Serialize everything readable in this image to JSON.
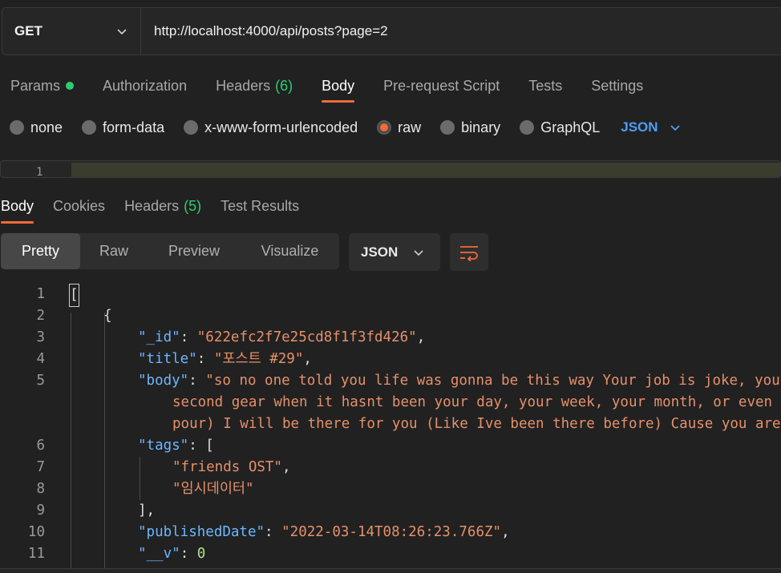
{
  "request": {
    "method": "GET",
    "url": "http://localhost:4000/api/posts?page=2"
  },
  "request_tabs": [
    {
      "label": "Params",
      "indicator": "green-dot"
    },
    {
      "label": "Authorization"
    },
    {
      "label": "Headers",
      "count": "(6)"
    },
    {
      "label": "Body",
      "active": true
    },
    {
      "label": "Pre-request Script"
    },
    {
      "label": "Tests"
    },
    {
      "label": "Settings"
    }
  ],
  "body_types": {
    "none": "none",
    "form_data": "form-data",
    "urlencoded": "x-www-form-urlencoded",
    "raw": "raw",
    "binary": "binary",
    "graphql": "GraphQL",
    "format": "JSON",
    "selected": "raw"
  },
  "request_editor": {
    "line_number": "1"
  },
  "response_tabs": {
    "body": "Body",
    "cookies": "Cookies",
    "headers": "Headers",
    "headers_count": "(5)",
    "test_results": "Test Results"
  },
  "view_modes": {
    "pretty": "Pretty",
    "raw": "Raw",
    "preview": "Preview",
    "visualize": "Visualize",
    "format": "JSON",
    "wrap_icon": "wrap-lines-icon"
  },
  "code_lines": [
    {
      "n": "1",
      "text": "["
    },
    {
      "n": "2",
      "text": "{"
    },
    {
      "n": "3",
      "key": "\"_id\"",
      "sep": ": ",
      "val": "\"622efc2f7e25cd8f1f3fd426\"",
      "end": ","
    },
    {
      "n": "4",
      "key": "\"title\"",
      "sep": ": ",
      "val": "\"포스트 #29\"",
      "end": ","
    },
    {
      "n": "5",
      "key": "\"body\"",
      "sep": ": ",
      "val": "\"so no one told you life was gonna be this way Your job is joke, you're broke, your love life's DOA It's like you're always stuck in"
    },
    {
      "n": "",
      "cont": "second gear when it hasnt been your day, your week, your month, or even your year, but I'll be there for you (When the rain starts to"
    },
    {
      "n": "",
      "cont": "pour) I will be there for you (Like Ive been there before) Cause you are there for me too\","
    },
    {
      "n": "6",
      "key": "\"tags\"",
      "sep": ": ",
      "val": "",
      "end": "["
    },
    {
      "n": "7",
      "val": "\"friends OST\"",
      "end": ","
    },
    {
      "n": "8",
      "val": "\"임시데이터\""
    },
    {
      "n": "9",
      "text": "],"
    },
    {
      "n": "10",
      "key": "\"publishedDate\"",
      "sep": ": ",
      "val": "\"2022-03-14T08:26:23.766Z\"",
      "end": ","
    },
    {
      "n": "11",
      "key": "\"__v\"",
      "sep": ": ",
      "num": "0"
    }
  ],
  "colors": {
    "accent": "#f26b3a",
    "link": "#4d9ef5",
    "success": "#2ecc71",
    "json_key": "#6cb6ff",
    "json_string": "#e6906a"
  }
}
